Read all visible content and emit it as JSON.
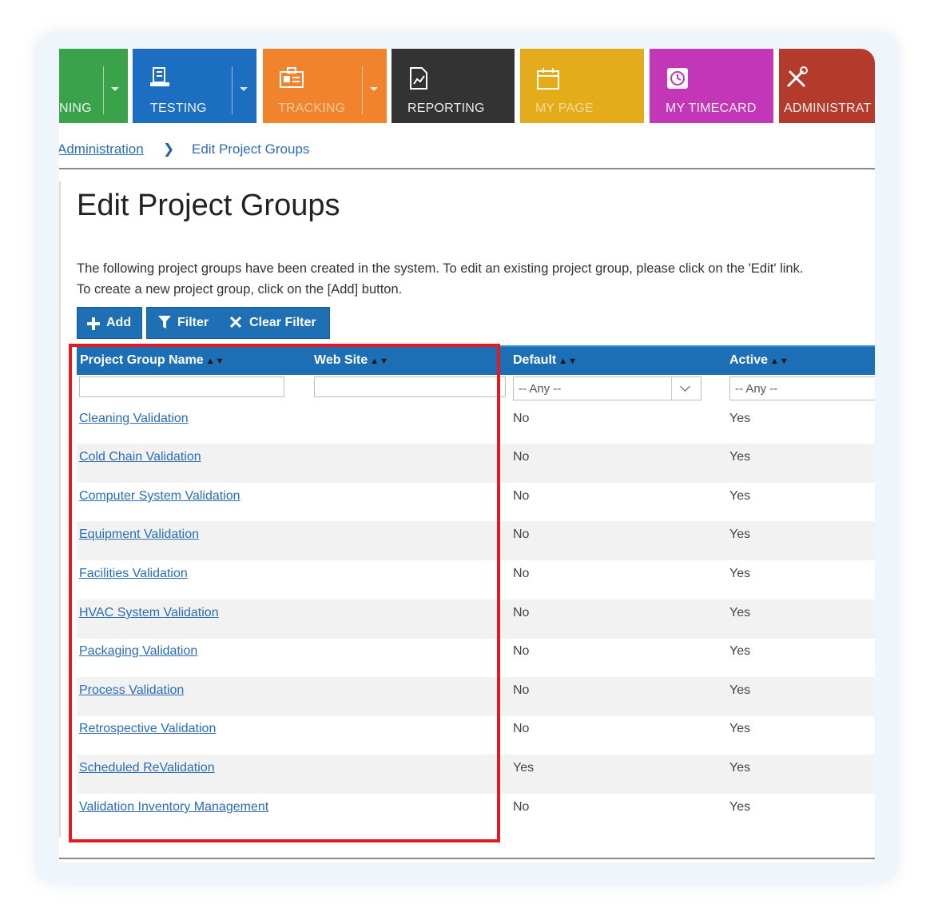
{
  "nav": {
    "tiles": [
      {
        "label": "NING",
        "color": "#3aa24b"
      },
      {
        "label": "TESTING",
        "color": "#1c6fc0"
      },
      {
        "label": "TRACKING",
        "color": "#f0832c"
      },
      {
        "label": "REPORTING",
        "color": "#333333"
      },
      {
        "label": "MY PAGE",
        "color": "#e4ac1b"
      },
      {
        "label": "MY TIMECARD",
        "color": "#c236b7"
      },
      {
        "label": "ADMINISTRAT",
        "color": "#b43a2c"
      }
    ]
  },
  "breadcrumb": {
    "parent": "Administration",
    "separator": "❯",
    "current": "Edit Project Groups"
  },
  "page": {
    "title": "Edit Project Groups",
    "description_line1": "The following project groups have been created in the system. To edit an existing project group, please click on the 'Edit' link.",
    "description_line2": "To create a new project group, click on the [Add] button."
  },
  "toolbar": {
    "add_label": "Add",
    "filter_label": "Filter",
    "clear_filter_label": "Clear Filter"
  },
  "table": {
    "columns": {
      "name": "Project Group Name",
      "website": "Web Site",
      "default": "Default",
      "active": "Active"
    },
    "sort_arrows": "▲▼",
    "filters": {
      "default_value": "-- Any --",
      "active_value": "-- Any --"
    },
    "rows": [
      {
        "name": "Cleaning Validation",
        "default": "No",
        "active": "Yes"
      },
      {
        "name": "Cold Chain Validation",
        "default": "No",
        "active": "Yes"
      },
      {
        "name": "Computer System Validation",
        "default": "No",
        "active": "Yes"
      },
      {
        "name": "Equipment Validation",
        "default": "No",
        "active": "Yes"
      },
      {
        "name": "Facilities Validation",
        "default": "No",
        "active": "Yes"
      },
      {
        "name": "HVAC System Validation",
        "default": "No",
        "active": "Yes"
      },
      {
        "name": "Packaging Validation",
        "default": "No",
        "active": "Yes"
      },
      {
        "name": "Process Validation",
        "default": "No",
        "active": "Yes"
      },
      {
        "name": "Retrospective Validation",
        "default": "No",
        "active": "Yes"
      },
      {
        "name": "Scheduled ReValidation",
        "default": "Yes",
        "active": "Yes"
      },
      {
        "name": "Validation Inventory Management",
        "default": "No",
        "active": "Yes"
      }
    ]
  },
  "highlight_color": "#e11b22"
}
